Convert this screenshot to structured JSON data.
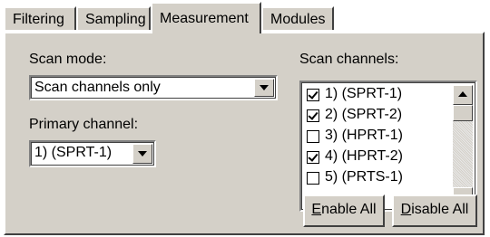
{
  "tabs": [
    {
      "label": "Filtering",
      "active": false
    },
    {
      "label": "Sampling",
      "active": false
    },
    {
      "label": "Measurement",
      "active": true
    },
    {
      "label": "Modules",
      "active": false
    }
  ],
  "scan_mode": {
    "label": "Scan mode:",
    "value": "Scan channels only"
  },
  "primary_channel": {
    "label": "Primary channel:",
    "value": "1) (SPRT-1)"
  },
  "scan_channels": {
    "label": "Scan channels:",
    "items": [
      {
        "label": "1) (SPRT-1)",
        "checked": true
      },
      {
        "label": "2) (SPRT-2)",
        "checked": true
      },
      {
        "label": "3) (HPRT-1)",
        "checked": false
      },
      {
        "label": "4) (HPRT-2)",
        "checked": true
      },
      {
        "label": "5) (PRTS-1)",
        "checked": false
      }
    ]
  },
  "buttons": {
    "enable_all": {
      "mnemonic": "E",
      "rest": "nable All"
    },
    "disable_all": {
      "mnemonic": "D",
      "rest": "isable All"
    }
  }
}
